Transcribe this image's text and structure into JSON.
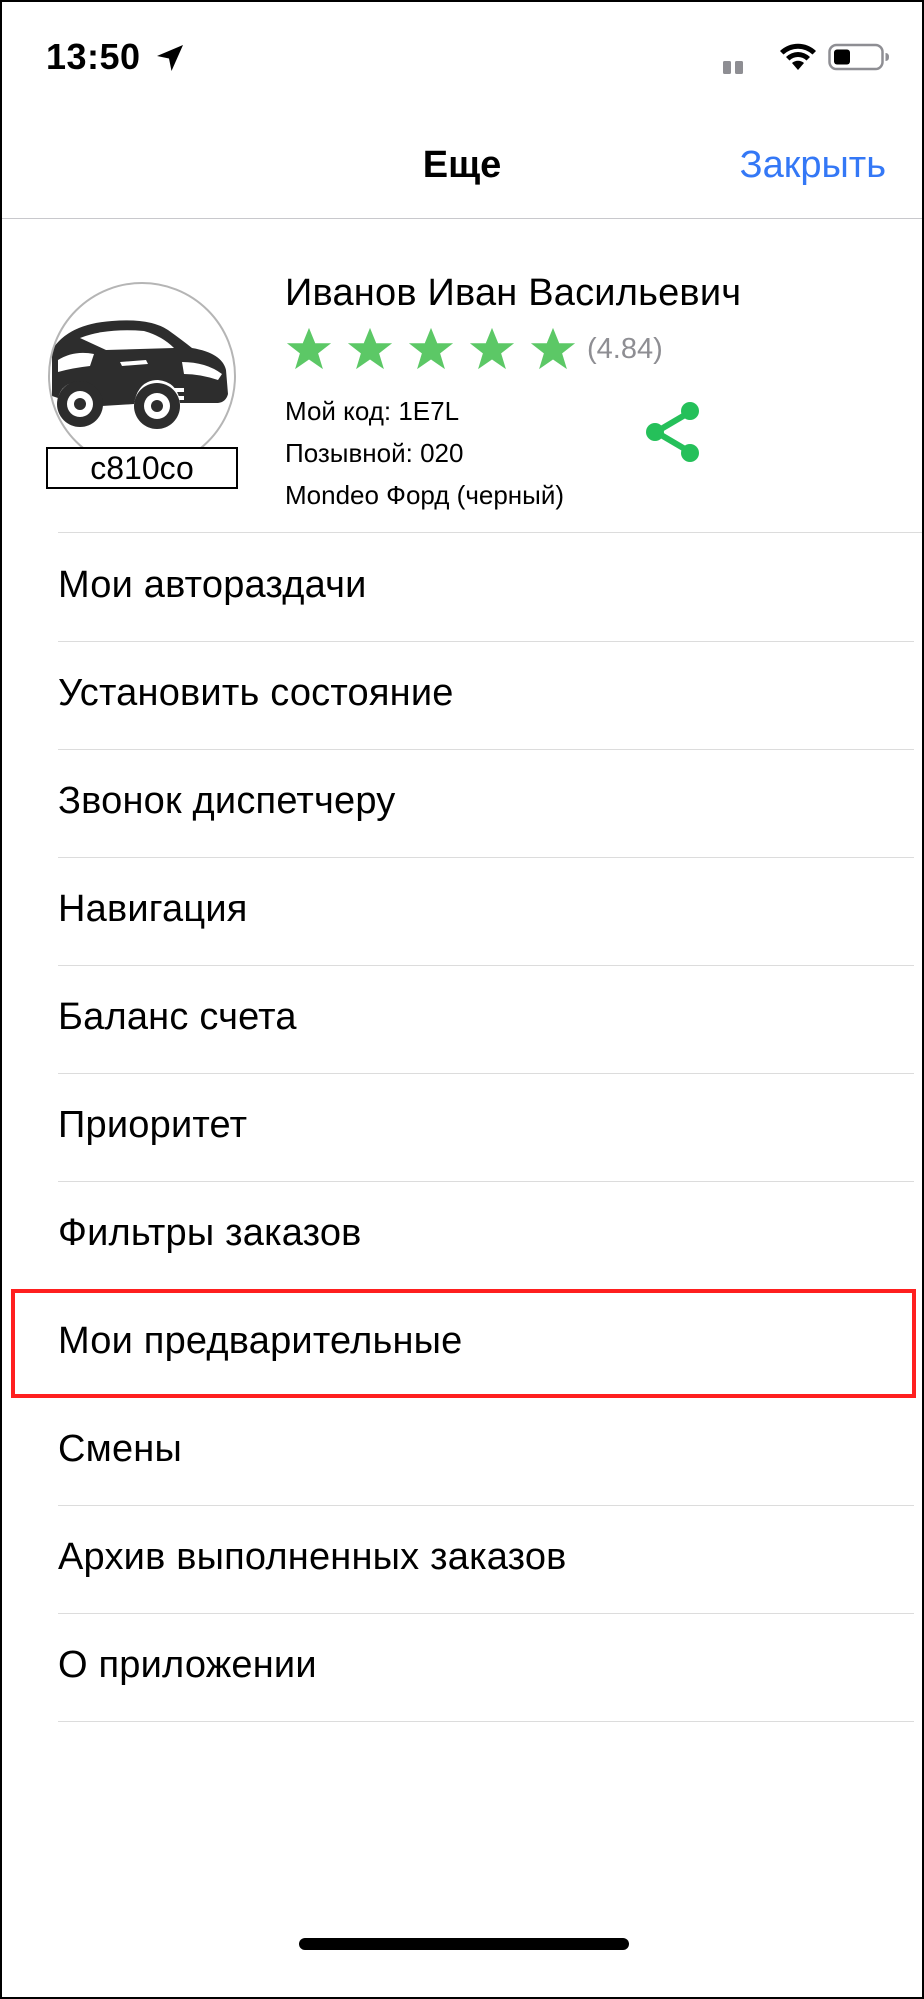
{
  "status_bar": {
    "time": "13:50",
    "icons": [
      "location-arrow-icon",
      "cellular-signal-icon",
      "wifi-icon",
      "battery-icon"
    ]
  },
  "nav": {
    "title": "Еще",
    "close_label": "Закрыть",
    "close_color": "#3478f6"
  },
  "profile": {
    "name": "Иванов Иван Васильевич",
    "stars": 5,
    "rating": "(4.84)",
    "star_color": "#5cc866",
    "code": "Мой код: 1E7L",
    "callsign": "Позывной: 020",
    "car": "Mondeo Форд (черный)",
    "plate": "с810со",
    "avatar_icon": "car-icon",
    "share_icon": "share-icon",
    "share_color": "#25c05a"
  },
  "menu": {
    "highlighted_index": 7,
    "highlight_color": "#ff1f1f",
    "items": [
      {
        "label": "Мои автораздачи"
      },
      {
        "label": "Установить состояние"
      },
      {
        "label": "Звонок диспетчеру"
      },
      {
        "label": "Навигация"
      },
      {
        "label": "Баланс счета"
      },
      {
        "label": "Приоритет"
      },
      {
        "label": "Фильтры заказов"
      },
      {
        "label": "Мои предварительные"
      },
      {
        "label": "Смены"
      },
      {
        "label": "Архив выполненных заказов"
      },
      {
        "label": "О приложении"
      }
    ]
  }
}
